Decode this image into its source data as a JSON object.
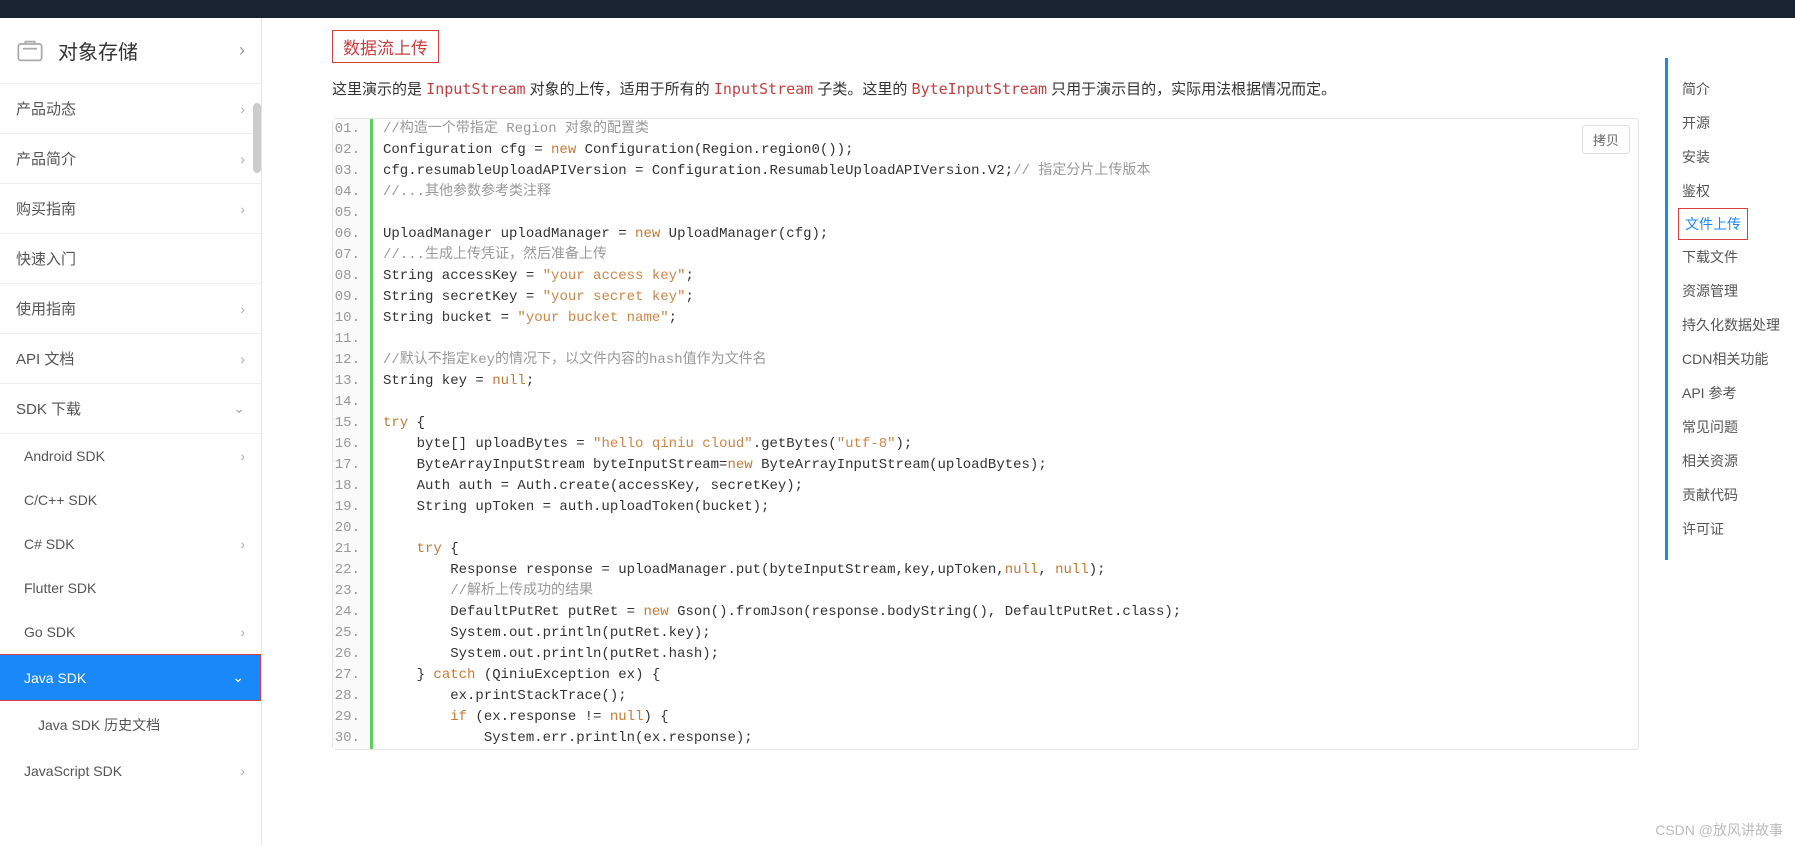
{
  "sidebar": {
    "title": "对象存储",
    "items": [
      {
        "label": "产品动态",
        "chev": "›"
      },
      {
        "label": "产品简介",
        "chev": "›"
      },
      {
        "label": "购买指南",
        "chev": "›"
      },
      {
        "label": "快速入门"
      },
      {
        "label": "使用指南",
        "chev": "›"
      },
      {
        "label": "API 文档",
        "chev": "›"
      },
      {
        "label": "SDK 下载",
        "chev": "⌄"
      }
    ],
    "sdk": [
      {
        "label": "Android SDK",
        "chev": "›"
      },
      {
        "label": "C/C++ SDK"
      },
      {
        "label": "C# SDK",
        "chev": "›"
      },
      {
        "label": "Flutter SDK"
      },
      {
        "label": "Go SDK",
        "chev": "›"
      },
      {
        "label": "Java SDK",
        "chev": "⌄"
      },
      {
        "label": "Java SDK 历史文档"
      },
      {
        "label": "JavaScript SDK",
        "chev": "›"
      }
    ]
  },
  "main": {
    "section_title": "数据流上传",
    "desc_parts": {
      "p1": "这里演示的是 ",
      "c1": "InputStream",
      "p2": " 对象的上传，适用于所有的 ",
      "c2": "InputStream",
      "p3": " 子类。这里的 ",
      "c3": "ByteInputStream",
      "p4": " 只用于演示目的，实际用法根据情况而定。"
    },
    "copy_label": "拷贝"
  },
  "code": [
    {
      "n": "01.",
      "t": [
        [
          "//构造一个带指定 Region 对象的配置类",
          "c"
        ]
      ]
    },
    {
      "n": "02.",
      "t": [
        [
          "Configuration cfg = ",
          "p"
        ],
        [
          "new",
          "k"
        ],
        [
          " Configuration(Region.region0());",
          "p"
        ]
      ]
    },
    {
      "n": "03.",
      "t": [
        [
          "cfg.resumableUploadAPIVersion = Configuration.ResumableUploadAPIVersion.V2;",
          "p"
        ],
        [
          "// 指定分片上传版本",
          "c"
        ]
      ]
    },
    {
      "n": "04.",
      "t": [
        [
          "//...其他参数参考类注释",
          "c"
        ]
      ]
    },
    {
      "n": "05.",
      "t": [
        [
          "",
          "p"
        ]
      ]
    },
    {
      "n": "06.",
      "t": [
        [
          "UploadManager uploadManager = ",
          "p"
        ],
        [
          "new",
          "k"
        ],
        [
          " UploadManager(cfg);",
          "p"
        ]
      ]
    },
    {
      "n": "07.",
      "t": [
        [
          "//...生成上传凭证，然后准备上传",
          "c"
        ]
      ]
    },
    {
      "n": "08.",
      "t": [
        [
          "String accessKey = ",
          "p"
        ],
        [
          "\"your access key\"",
          "s"
        ],
        [
          ";",
          "p"
        ]
      ]
    },
    {
      "n": "09.",
      "t": [
        [
          "String secretKey = ",
          "p"
        ],
        [
          "\"your secret key\"",
          "s"
        ],
        [
          ";",
          "p"
        ]
      ]
    },
    {
      "n": "10.",
      "t": [
        [
          "String bucket = ",
          "p"
        ],
        [
          "\"your bucket name\"",
          "s"
        ],
        [
          ";",
          "p"
        ]
      ]
    },
    {
      "n": "11.",
      "t": [
        [
          "",
          "p"
        ]
      ]
    },
    {
      "n": "12.",
      "t": [
        [
          "//默认不指定key的情况下，以文件内容的hash值作为文件名",
          "c"
        ]
      ]
    },
    {
      "n": "13.",
      "t": [
        [
          "String key = ",
          "p"
        ],
        [
          "null",
          "k"
        ],
        [
          ";",
          "p"
        ]
      ]
    },
    {
      "n": "14.",
      "t": [
        [
          "",
          "p"
        ]
      ]
    },
    {
      "n": "15.",
      "t": [
        [
          "try",
          "k"
        ],
        [
          " {",
          "p"
        ]
      ]
    },
    {
      "n": "16.",
      "t": [
        [
          "    byte[] uploadBytes = ",
          "p"
        ],
        [
          "\"hello qiniu cloud\"",
          "s"
        ],
        [
          ".getBytes(",
          "p"
        ],
        [
          "\"utf-8\"",
          "s"
        ],
        [
          ");",
          "p"
        ]
      ]
    },
    {
      "n": "17.",
      "t": [
        [
          "    ByteArrayInputStream byteInputStream=",
          "p"
        ],
        [
          "new",
          "k"
        ],
        [
          " ByteArrayInputStream(uploadBytes);",
          "p"
        ]
      ]
    },
    {
      "n": "18.",
      "t": [
        [
          "    Auth auth = Auth.create(accessKey, secretKey);",
          "p"
        ]
      ]
    },
    {
      "n": "19.",
      "t": [
        [
          "    String upToken = auth.uploadToken(bucket);",
          "p"
        ]
      ]
    },
    {
      "n": "20.",
      "t": [
        [
          "",
          "p"
        ]
      ]
    },
    {
      "n": "21.",
      "t": [
        [
          "    ",
          "p"
        ],
        [
          "try",
          "k"
        ],
        [
          " {",
          "p"
        ]
      ]
    },
    {
      "n": "22.",
      "t": [
        [
          "        Response response = uploadManager.put(byteInputStream,key,upToken,",
          "p"
        ],
        [
          "null",
          "k"
        ],
        [
          ", ",
          "p"
        ],
        [
          "null",
          "k"
        ],
        [
          ");",
          "p"
        ]
      ]
    },
    {
      "n": "23.",
      "t": [
        [
          "        ",
          "p"
        ],
        [
          "//解析上传成功的结果",
          "c"
        ]
      ]
    },
    {
      "n": "24.",
      "t": [
        [
          "        DefaultPutRet putRet = ",
          "p"
        ],
        [
          "new",
          "k"
        ],
        [
          " Gson().fromJson(response.bodyString(), DefaultPutRet.class);",
          "p"
        ]
      ]
    },
    {
      "n": "25.",
      "t": [
        [
          "        System.out.println(putRet.key);",
          "p"
        ]
      ]
    },
    {
      "n": "26.",
      "t": [
        [
          "        System.out.println(putRet.hash);",
          "p"
        ]
      ]
    },
    {
      "n": "27.",
      "t": [
        [
          "    } ",
          "p"
        ],
        [
          "catch",
          "k"
        ],
        [
          " (QiniuException ex) {",
          "p"
        ]
      ]
    },
    {
      "n": "28.",
      "t": [
        [
          "        ex.printStackTrace();",
          "p"
        ]
      ]
    },
    {
      "n": "29.",
      "t": [
        [
          "        ",
          "p"
        ],
        [
          "if",
          "k"
        ],
        [
          " (ex.response != ",
          "p"
        ],
        [
          "null",
          "k"
        ],
        [
          ") {",
          "p"
        ]
      ]
    },
    {
      "n": "30.",
      "t": [
        [
          "            System.err.println(ex.response);",
          "p"
        ]
      ]
    }
  ],
  "rightnav": [
    "简介",
    "开源",
    "安装",
    "鉴权",
    "文件上传",
    "下载文件",
    "资源管理",
    "持久化数据处理",
    "CDN相关功能",
    "API 参考",
    "常见问题",
    "相关资源",
    "贡献代码",
    "许可证"
  ],
  "watermark": "CSDN @放风讲故事"
}
